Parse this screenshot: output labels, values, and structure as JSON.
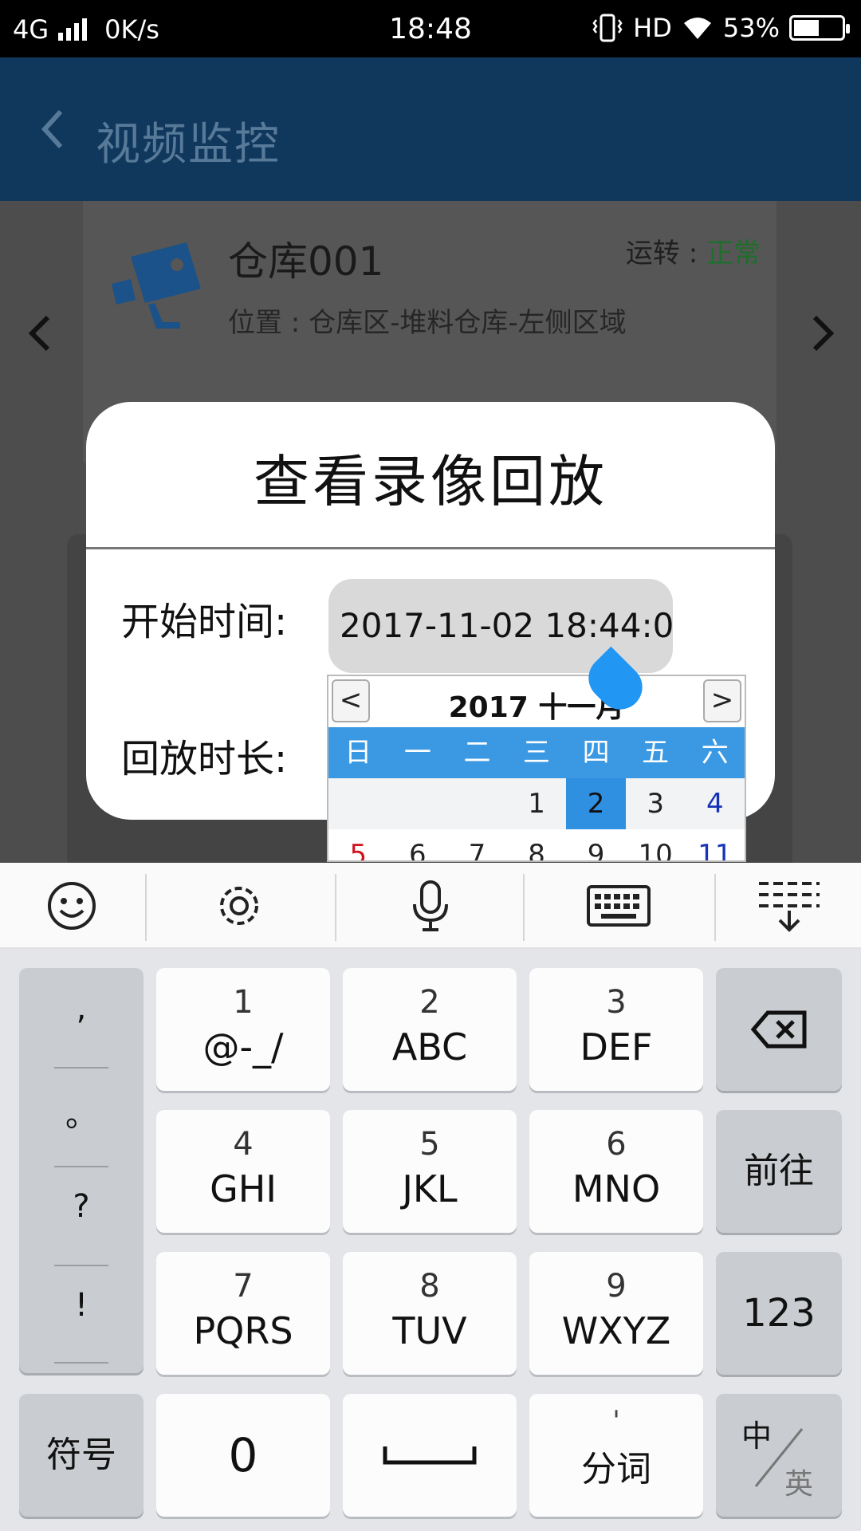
{
  "status_bar": {
    "network": "4G",
    "speed": "0K/s",
    "time": "18:48",
    "hd": "HD",
    "battery": "53%",
    "battery_level": 0.53
  },
  "app": {
    "title": "视频监控",
    "card": {
      "name": "仓库001",
      "status_label": "运转 : ",
      "status_value": "正常",
      "location": "位置 : 仓库区-堆料仓库-左侧区域",
      "status_color": "#2e9e44",
      "icon": "camera-icon"
    }
  },
  "dialog": {
    "title": "查看录像回放",
    "start_label": "开始时间:",
    "start_value": "2017-11-02 18:44:0",
    "duration_label": "回放时长:"
  },
  "calendar": {
    "prev": "<",
    "next": ">",
    "title": "2017 十一月",
    "weekdays": [
      "日",
      "一",
      "二",
      "三",
      "四",
      "五",
      "六"
    ],
    "week1": [
      "",
      "",
      "",
      "1",
      "2",
      "3",
      "4"
    ],
    "week2": [
      "5",
      "6",
      "7",
      "8",
      "9",
      "10",
      "11"
    ],
    "selected_day": "2",
    "accent_color": "#3b99e3"
  },
  "keyboard": {
    "toolbar_icons": [
      "emoji-icon",
      "settings-icon",
      "microphone-icon",
      "keyboard-icon",
      "collapse-keyboard-icon"
    ],
    "punctuation": [
      ",",
      "。",
      "?",
      "!"
    ],
    "keys": [
      {
        "num": "1",
        "letters": "@-_/"
      },
      {
        "num": "2",
        "letters": "ABC"
      },
      {
        "num": "3",
        "letters": "DEF"
      },
      {
        "num": "4",
        "letters": "GHI"
      },
      {
        "num": "5",
        "letters": "JKL"
      },
      {
        "num": "6",
        "letters": "MNO"
      },
      {
        "num": "7",
        "letters": "PQRS"
      },
      {
        "num": "8",
        "letters": "TUV"
      },
      {
        "num": "9",
        "letters": "WXYZ"
      }
    ],
    "go": "前往",
    "numbers": "123",
    "symbols": "符号",
    "zero": "0",
    "fenci_mark": "'",
    "fenci": "分词",
    "lang_zh": "中",
    "lang_en": "英"
  }
}
